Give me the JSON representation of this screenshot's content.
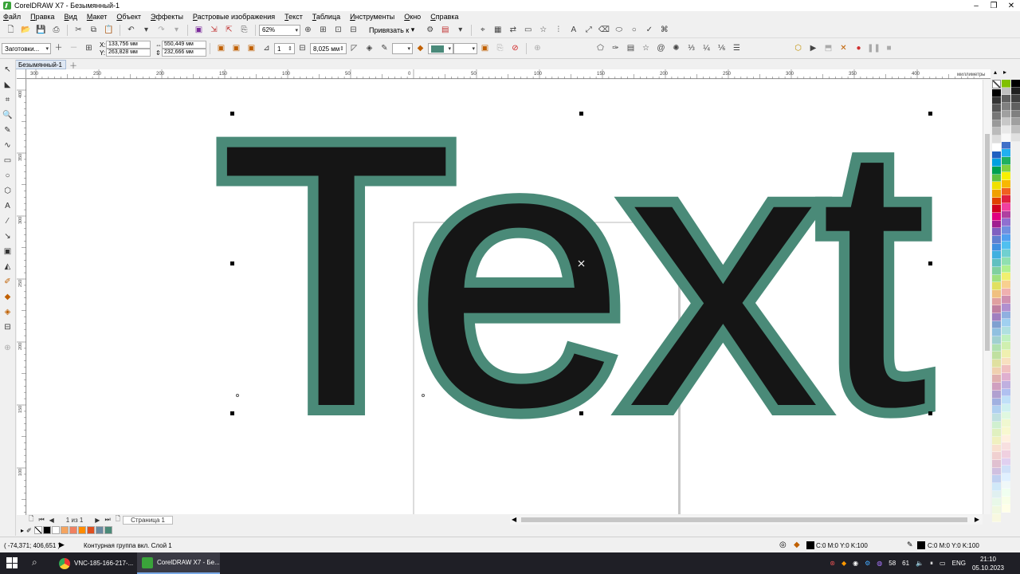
{
  "window": {
    "title": "CorelDRAW X7 - Безымянный-1",
    "minimize": "–",
    "restore": "❐",
    "close": "✕"
  },
  "menu": [
    "Файл",
    "Правка",
    "Вид",
    "Макет",
    "Объект",
    "Эффекты",
    "Растровые изображения",
    "Текст",
    "Таблица",
    "Инструменты",
    "Окно",
    "Справка"
  ],
  "toolbar": {
    "zoom": "62%",
    "snap_label": "Привязать к"
  },
  "property_bar": {
    "preset": "Заготовки...",
    "x": "133,756 мм",
    "y": "263,828 мм",
    "width": "550,449 мм",
    "height": "232,666 мм",
    "steps": "1",
    "offset": "8,025 мм",
    "outline_color": "#4a8a7a"
  },
  "document": {
    "tab_name": "Безымянный-1",
    "page_nav_count": "1 из 1",
    "page_tab": "Страница 1"
  },
  "canvas": {
    "text": "Text",
    "fill_color": "#151515",
    "contour_color": "#4a8a78",
    "ruler_units": "миллиметры",
    "h_ticks": [
      "300",
      "250",
      "200",
      "150",
      "100",
      "50",
      "0",
      "50",
      "100",
      "150",
      "200",
      "250",
      "300",
      "350",
      "400"
    ],
    "v_ticks": [
      "400",
      "350",
      "300",
      "250",
      "200",
      "150",
      "100"
    ]
  },
  "status": {
    "coords": "( -74,371; 406,651 )",
    "info": "Контурная группа вкл. Слой 1",
    "fill": "C:0 M:0 Y:0 K:100",
    "outline": "C:0 M:0 Y:0 K:100"
  },
  "taskbar": {
    "task1": "VNC-185-166-217-...",
    "task2": "CorelDRAW X7 - Бе...",
    "tray_a": "58",
    "tray_b": "61",
    "lang": "ENG",
    "time": "21:10",
    "date": "05.10.2023"
  },
  "doc_palette_colors": [
    "#000000",
    "#ffffff",
    "#f4a460",
    "#f08060",
    "#ff8c00",
    "#e05020",
    "#6a8aa0",
    "#4a8a78"
  ],
  "palette_col1": [
    "#000000",
    "#333333",
    "#555555",
    "#777777",
    "#999999",
    "#bbbbbb",
    "#dddddd",
    "#ffffff",
    "#2060c0",
    "#00a0e0",
    "#00a050",
    "#60c040",
    "#f0e000",
    "#f0a000",
    "#e04000",
    "#d00020",
    "#e00080",
    "#a02090",
    "#8060c0",
    "#6080d0",
    "#4090e0",
    "#40b0e0",
    "#60c0c0",
    "#80d0a0",
    "#a0e080",
    "#e0e060",
    "#f0c080",
    "#e0a0a0",
    "#c080a0",
    "#a080c0",
    "#80a0d0",
    "#90c0e0",
    "#a0d0d0",
    "#b0e0b0",
    "#c0e0a0",
    "#e0e0a0",
    "#f0d0b0",
    "#e0b0b0",
    "#d0a0c0",
    "#b0a0d0",
    "#a0b0e0",
    "#b0d0f0",
    "#c0e0e0",
    "#d0f0d0",
    "#e0f0c0",
    "#f0f0c0",
    "#f8e0d0",
    "#f0d0d0",
    "#e0c0d0",
    "#d0c0e0",
    "#c0d0f0",
    "#d0e8f8",
    "#e0f0f0",
    "#e8f8e8",
    "#f0f8e0",
    "#f8f8e0"
  ],
  "palette_col2": [
    "#80c000",
    "#c0c0c0",
    "#606060",
    "#808080",
    "#a0a0a0",
    "#c8c8c8",
    "#e8e8e8",
    "#f8f8f8",
    "#4070c8",
    "#20b0f0",
    "#20b060",
    "#80d040",
    "#f8f000",
    "#f8b800",
    "#f06020",
    "#e02040",
    "#f040a0",
    "#b040a0",
    "#9070d0",
    "#7090e0",
    "#50a0f0",
    "#50c0f0",
    "#70d0d0",
    "#90e0b0",
    "#b0f090",
    "#f0f070",
    "#f8d090",
    "#f0b0b0",
    "#d090b0",
    "#b090d0",
    "#90b0e0",
    "#a0d0f0",
    "#b0e0e0",
    "#c0f0c0",
    "#d0f0b0",
    "#f0f0b0",
    "#f8e0c0",
    "#f0c0c0",
    "#e0b0d0",
    "#c0b0e0",
    "#b0c0f0",
    "#c0e0f8",
    "#d0f0f0",
    "#e0f8e0",
    "#f0f8d0",
    "#f8f8d0",
    "#fff0e0",
    "#f8e0e0",
    "#f0d0e0",
    "#e0d0f0",
    "#d0e0f8",
    "#e0f0ff",
    "#f0f8f8",
    "#f0fff0",
    "#f8ffe8",
    "#ffffe8"
  ],
  "palette_col3": [
    "#000000",
    "#202020",
    "#404040",
    "#606060",
    "#808080",
    "#a0a0a0",
    "#c0c0c0",
    "#e0e0e0"
  ]
}
